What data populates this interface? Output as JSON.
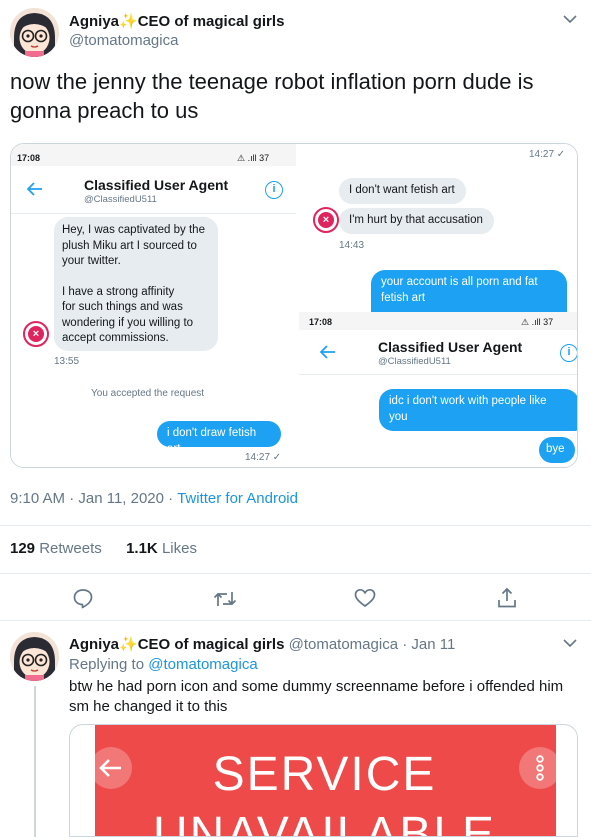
{
  "tweet": {
    "author_name": "Agniya",
    "author_title": "CEO of magical girls",
    "handle": "@tomatomagica",
    "text": "now the jenny the teenage robot inflation porn dude is gonna preach to us",
    "timestamp": "9:10 AM · Jan 11, 2020",
    "dot": "·",
    "source": "Twitter for Android",
    "retweets_count": "129",
    "retweets_label": "Retweets",
    "likes_count": "1.1K",
    "likes_label": "Likes"
  },
  "screenshot_left": {
    "status_time": "17:08",
    "status_icons": "⚠ .ıll 37",
    "agent_name": "Classified User Agent",
    "agent_handle": "@ClassifiedU511",
    "message_lines": [
      "Hey, I was captivated by the",
      "plush Miku art I sourced to",
      "your twitter.",
      "",
      "I have a strong affinity",
      "for such things and was",
      "wondering if you willing to",
      "accept commissions."
    ],
    "message_time": "13:55",
    "accepted": "You accepted the request",
    "reply": "i don't draw fetish art",
    "reply_time": "14:27 ✓"
  },
  "screenshot_right": {
    "top_time": "14:27 ✓",
    "msg1": "I don't want fetish art",
    "msg2": "I'm hurt by that accusation",
    "msg_time": "14:43",
    "blue1_line1": "your account is all porn and fat",
    "blue1_line2": "fetish art",
    "status_time": "17:08",
    "status_icons": "⚠ .ıll 37",
    "agent_name": "Classified User Agent",
    "agent_handle": "@ClassifiedU511",
    "blue2_line1": "idc i don't work with people like",
    "blue2_line2": "you",
    "blue3": "bye"
  },
  "actions": [
    "reply-icon",
    "retweet-icon",
    "like-icon",
    "share-icon"
  ],
  "reply_tweet": {
    "author_name": "Agniya",
    "author_title": "CEO of magical girls",
    "handle": "@tomatomagica",
    "dot": "·",
    "date": "Jan 11",
    "replying_label": "Replying to",
    "replying_handle": "@tomatomagica",
    "text_line1": "btw he had porn icon and some dummy screenname before i offended him",
    "text_line2": "sm he changed it to this",
    "card_text_line1": "SERVICE",
    "card_text_line2": "UNAVAILABLE"
  },
  "colors": {
    "accent": "#1da1f2",
    "link": "#1b95e0",
    "muted": "#657786",
    "error_red": "#e0245e",
    "card_red": "#ee4a4a"
  }
}
